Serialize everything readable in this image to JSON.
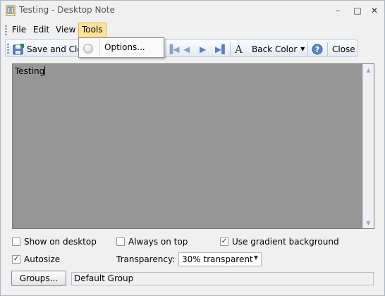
{
  "window": {
    "title": "Testing - Desktop Note"
  },
  "titlebar": {
    "minimize": "–",
    "maximize": "□",
    "close": "✕"
  },
  "menu": {
    "items": [
      "File",
      "Edit",
      "View",
      "Tools"
    ]
  },
  "toolbar": {
    "save_label": "Save and Clos",
    "back_color_label": "Back Color",
    "font_letter": "A",
    "close_label": "Close"
  },
  "dropdown": {
    "items": [
      "Options..."
    ]
  },
  "note": {
    "text": "Testing"
  },
  "options": {
    "show_on_desktop": {
      "label": "Show on desktop",
      "checked": false
    },
    "always_on_top": {
      "label": "Always on top",
      "checked": false
    },
    "use_gradient": {
      "label": "Use gradient background",
      "checked": true
    },
    "autosize": {
      "label": "Autosize",
      "checked": true
    },
    "transparency_label": "Transparency:",
    "transparency_value": "30% transparent"
  },
  "groups": {
    "button_label": "Groups...",
    "value": "Default Group"
  },
  "colors": {
    "note_bg": "#969696",
    "menu_highlight": "#fde39a"
  }
}
